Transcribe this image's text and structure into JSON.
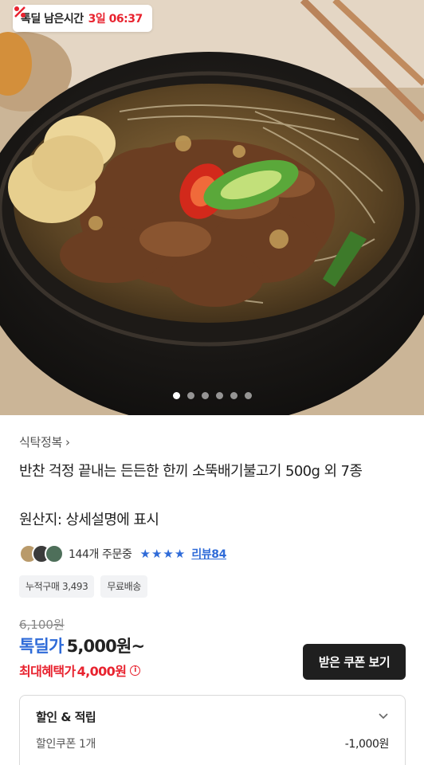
{
  "hero": {
    "timer_label": "톡딜 남은시간",
    "timer_value": "3일 06:37",
    "slide_count": 6,
    "active_slide": 1
  },
  "product": {
    "brand": "식탁정복",
    "title": "반찬 걱정 끝내는 든든한 한끼 소뚝배기불고기 500g 외 7종",
    "origin": "원산지: 상세설명에 표시",
    "order_count": "144개 주문중",
    "rating_stars": 4,
    "review_label": "리뷰84",
    "tags": [
      "누적구매 3,493",
      "무료배송"
    ]
  },
  "price": {
    "original": "6,100원",
    "label": "톡딜가",
    "value": "5,000원~",
    "benefit_label": "최대혜택가",
    "benefit_value": "4,000원",
    "coupon_button": "받은 쿠폰 보기"
  },
  "discount": {
    "heading": "할인 & 적립",
    "row_label": "할인쿠폰 1개",
    "row_value": "-1,000원"
  },
  "colors": {
    "accent_blue": "#2f6bd8",
    "accent_red": "#e8232f",
    "button_dark": "#1f1f1f"
  }
}
